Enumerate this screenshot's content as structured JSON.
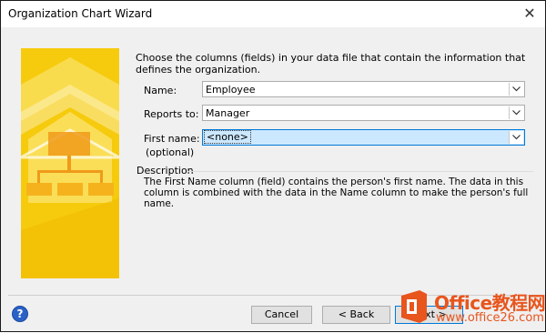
{
  "window": {
    "title": "Organization Chart Wizard"
  },
  "intro_text": "Choose the columns (fields) in your data file that contain the information that defines the organization.",
  "fields": {
    "name": {
      "label": "Name:",
      "value": "Employee"
    },
    "reports_to": {
      "label": "Reports to:",
      "value": "Manager"
    },
    "first_name": {
      "label": "First name:",
      "sublabel": "(optional)",
      "value": "<none>"
    }
  },
  "description": {
    "title": "Description",
    "text": "The First Name column (field) contains the person's first name. The data in this column is combined with the data in the Name column to make the person's full name."
  },
  "buttons": {
    "cancel": "Cancel",
    "back": "< Back",
    "next": "Next >"
  },
  "watermark": {
    "line1": "Office教程网",
    "line2": "www.office26.com"
  },
  "colors": {
    "banner_yellow": "#f5c400",
    "accent": "#0078d7",
    "watermark_orange": "#e8551d"
  },
  "icons": {
    "close": "close-icon",
    "help": "help-icon",
    "dropdown": "chevron-down-icon"
  }
}
